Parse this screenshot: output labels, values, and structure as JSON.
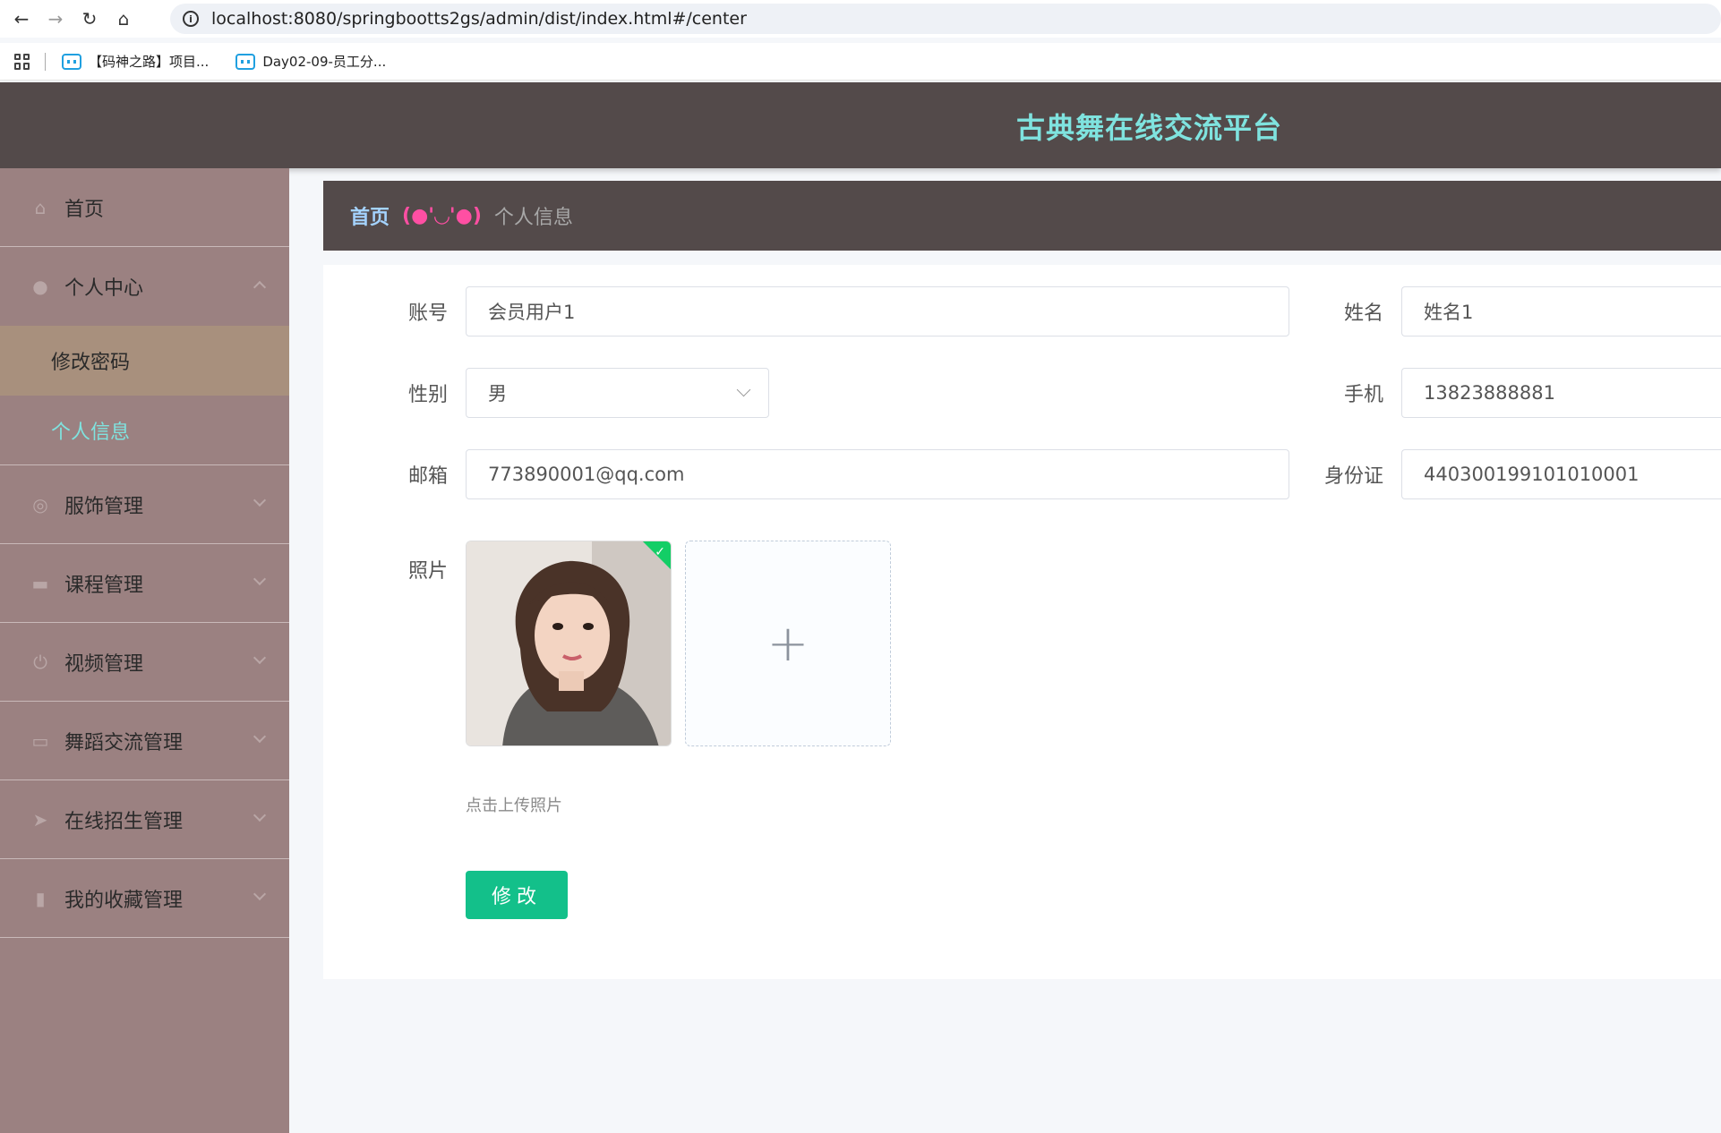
{
  "browser": {
    "url": "localhost:8080/springbootts2gs/admin/dist/index.html#/center",
    "bookmarks": [
      "【码神之路】项目...",
      "Day02-09-员工分..."
    ]
  },
  "header": {
    "title": "古典舞在线交流平台"
  },
  "sidebar": {
    "items": [
      {
        "label": "首页",
        "icon": "home-icon"
      },
      {
        "label": "个人中心",
        "icon": "user-icon",
        "expanded": true,
        "children": [
          {
            "label": "修改密码"
          },
          {
            "label": "个人信息"
          }
        ]
      },
      {
        "label": "服饰管理",
        "icon": "circle-icon"
      },
      {
        "label": "课程管理",
        "icon": "ticket-icon"
      },
      {
        "label": "视频管理",
        "icon": "power-icon"
      },
      {
        "label": "舞蹈交流管理",
        "icon": "monitor-icon"
      },
      {
        "label": "在线招生管理",
        "icon": "send-icon"
      },
      {
        "label": "我的收藏管理",
        "icon": "bookmark-icon"
      }
    ]
  },
  "breadcrumb": {
    "home": "首页",
    "face": "(●'◡'●)",
    "current": "个人信息"
  },
  "form": {
    "account_label": "账号",
    "account_value": "会员用户1",
    "name_label": "姓名",
    "name_value": "姓名1",
    "gender_label": "性别",
    "gender_value": "男",
    "phone_label": "手机",
    "phone_value": "13823888881",
    "email_label": "邮箱",
    "email_value": "773890001@qq.com",
    "idcard_label": "身份证",
    "idcard_value": "440300199101010001",
    "photo_label": "照片",
    "upload_plus": "+",
    "upload_tip": "点击上传照片",
    "submit_label": "修改"
  },
  "colors": {
    "header_bg": "#534a4a",
    "title": "#7fe3df",
    "sidebar_bg": "#9b8181",
    "accent_green": "#13c08a"
  }
}
